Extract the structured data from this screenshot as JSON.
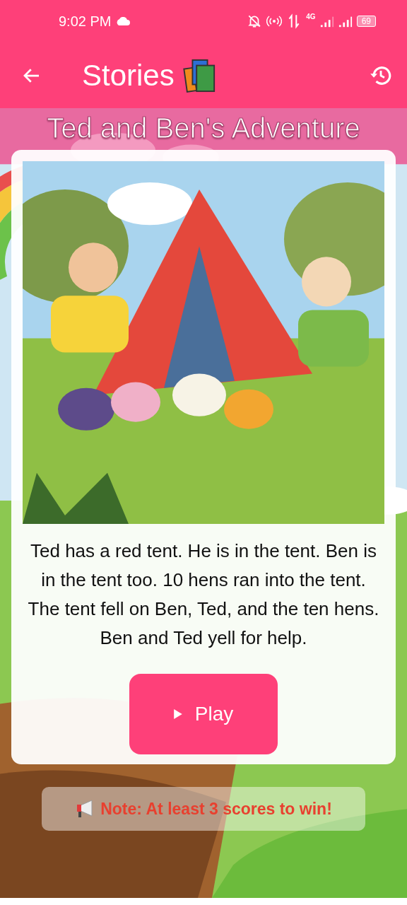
{
  "status_bar": {
    "time": "9:02 PM",
    "network": "4G",
    "battery": "69"
  },
  "app_bar": {
    "title": "Stories"
  },
  "story": {
    "title": "Ted and Ben's Adventure",
    "text": "Ted has a red tent. He is in the tent. Ben is in the tent too. 10 hens ran into the tent. The tent fell on Ben, Ted, and the ten hens. Ben and Ted yell for help.",
    "play_button": "Play"
  },
  "note": "Note: At least 3 scores to win!"
}
